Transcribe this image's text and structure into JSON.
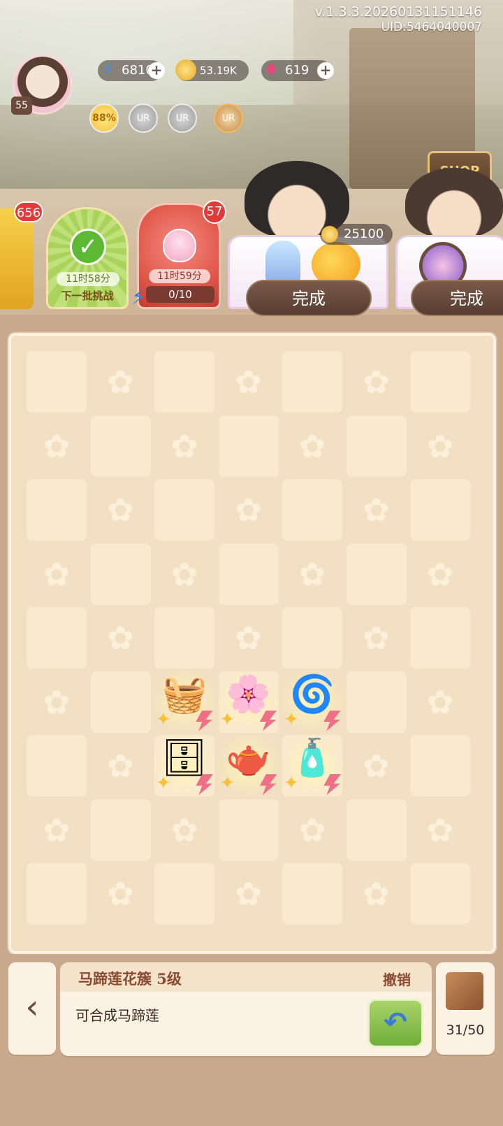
{
  "header": {
    "version": "v.1.3.3.20260131151146",
    "uid": "UID:5464040007"
  },
  "player": {
    "level": "55"
  },
  "resources": {
    "energy": "6810",
    "coins": "53.19K",
    "gems": "619"
  },
  "boosts": {
    "up_percent": "88%",
    "ur_badge_1": "UR",
    "ur_badge_2": "UR",
    "ur_badge_3": "UR"
  },
  "shop": {
    "label": "SHOP"
  },
  "tasks": {
    "side_count": "656",
    "green_card": {
      "timer": "11时58分",
      "label": "下一批挑战"
    },
    "red_card": {
      "count": "57",
      "timer": "11时59分",
      "progress": "0/10"
    }
  },
  "orders": [
    {
      "reward": "25100",
      "button": "完成"
    },
    {
      "button": "完成"
    }
  ],
  "board": {
    "items": [
      {
        "name": "gift-basket",
        "emoji": "🧺"
      },
      {
        "name": "flower-cage",
        "emoji": "🌸"
      },
      {
        "name": "galaxy-swirl",
        "emoji": "🌀"
      },
      {
        "name": "golden-cabinet",
        "emoji": "🗄"
      },
      {
        "name": "red-teapot",
        "emoji": "🫖"
      },
      {
        "name": "perfume-bottle",
        "emoji": "🧴"
      }
    ]
  },
  "info": {
    "title": "马蹄莲花簇 5级",
    "undo": "撤销",
    "description": "可合成马蹄莲"
  },
  "storage": {
    "count": "31/50"
  },
  "colors": {
    "board_bg": "#f3e0c2",
    "cell_light": "#f9e9cf",
    "accent_brown": "#8a4a32",
    "badge_red": "#e23a3a",
    "undo_green": "#6fae3a"
  }
}
